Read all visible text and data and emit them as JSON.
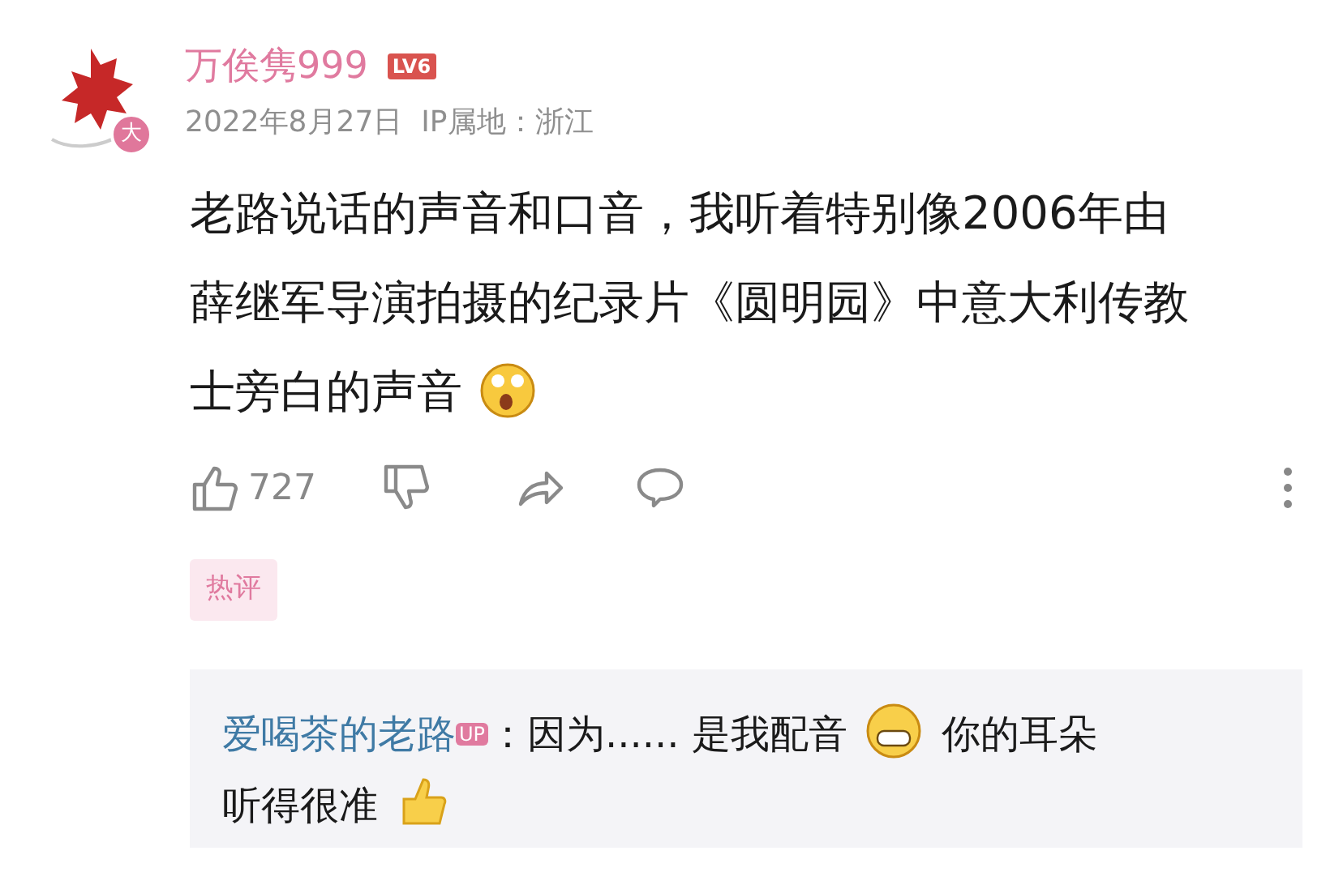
{
  "comment": {
    "avatar_badge": "大",
    "username": "万俟隽999",
    "level_badge": "LV6",
    "meta": "2022年8月27日  IP属地：浙江",
    "body_lines": [
      [
        {
          "kind": "text",
          "text": "老路说话的声音和口音，我听着特别像2006年由"
        }
      ],
      [
        {
          "kind": "text",
          "text": "薛继军导演拍摄的纪录片《圆明园》中意大利传教"
        }
      ],
      [
        {
          "kind": "text",
          "text": "士旁白的声音"
        },
        {
          "kind": "surprised"
        }
      ]
    ],
    "like_count": "727",
    "tag": "热评",
    "reply": {
      "author": "爱喝茶的老路",
      "author_badge": "UP",
      "lines": [
        [
          {
            "kind": "text",
            "text": "：因为...... 是我配音"
          },
          {
            "kind": "grin"
          },
          {
            "kind": "text",
            "text": "你的耳朵"
          }
        ],
        [
          {
            "kind": "text",
            "text": "听得很准"
          },
          {
            "kind": "thumbsup"
          }
        ]
      ]
    }
  }
}
